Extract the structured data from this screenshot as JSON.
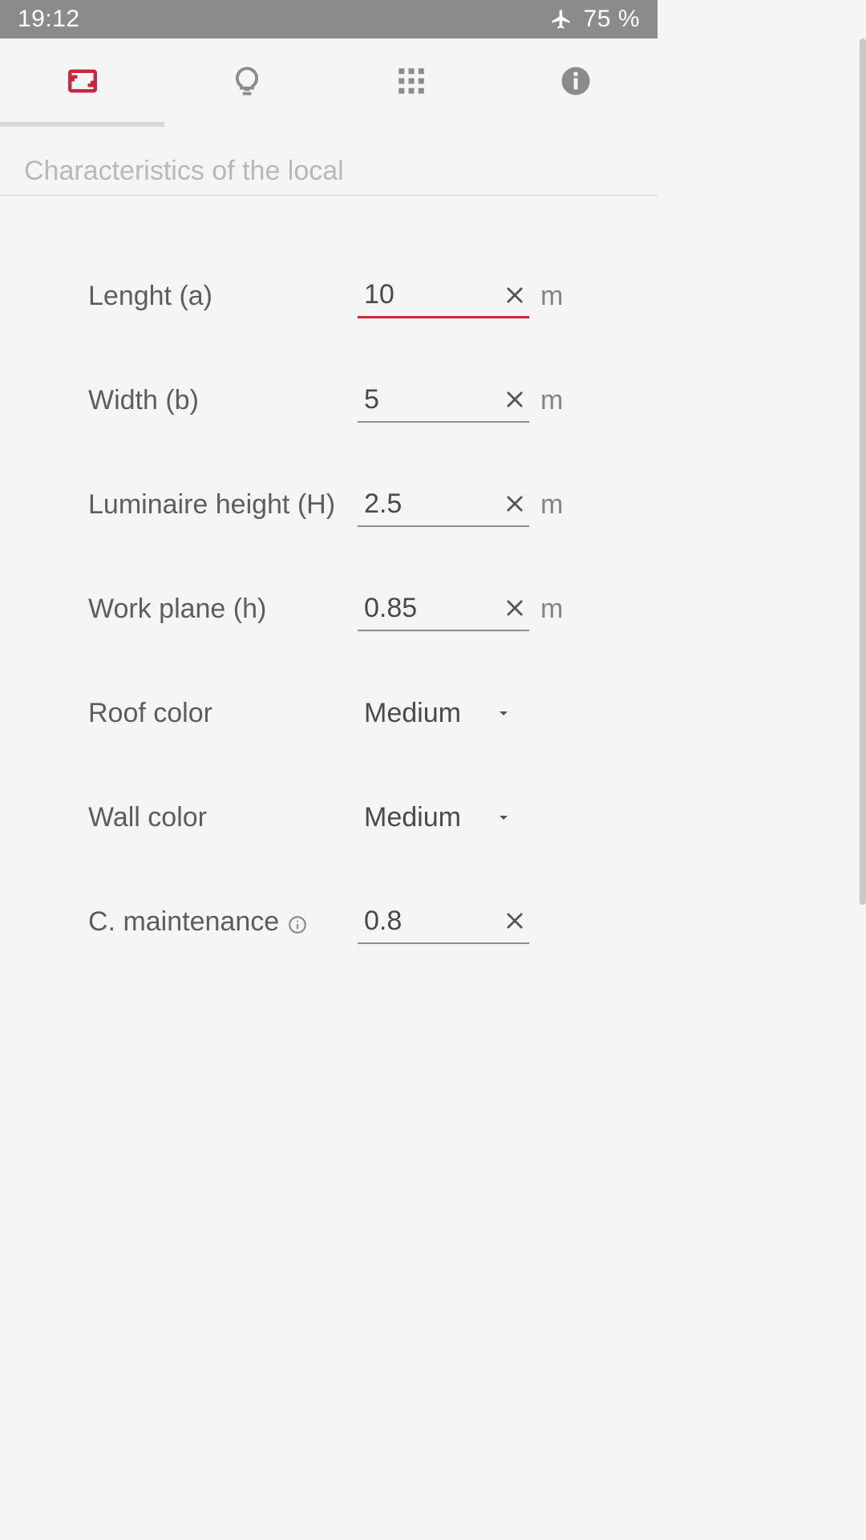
{
  "status": {
    "time": "19:12",
    "battery": "75 %"
  },
  "section_title": "Characteristics of the local",
  "fields": {
    "length": {
      "label": "Lenght (a)",
      "value": "10",
      "unit": "m"
    },
    "width": {
      "label": "Width (b)",
      "value": "5",
      "unit": "m"
    },
    "height": {
      "label": "Luminaire height (H)",
      "value": "2.5",
      "unit": "m"
    },
    "workplane": {
      "label": "Work plane (h)",
      "value": "0.85",
      "unit": "m"
    },
    "roof": {
      "label": "Roof color",
      "value": "Medium"
    },
    "wall": {
      "label": "Wall color",
      "value": "Medium"
    },
    "maint": {
      "label": "C. maintenance",
      "value": "0.8"
    }
  },
  "colors": {
    "accent": "#c8263f",
    "muted": "#8b8b8b"
  }
}
